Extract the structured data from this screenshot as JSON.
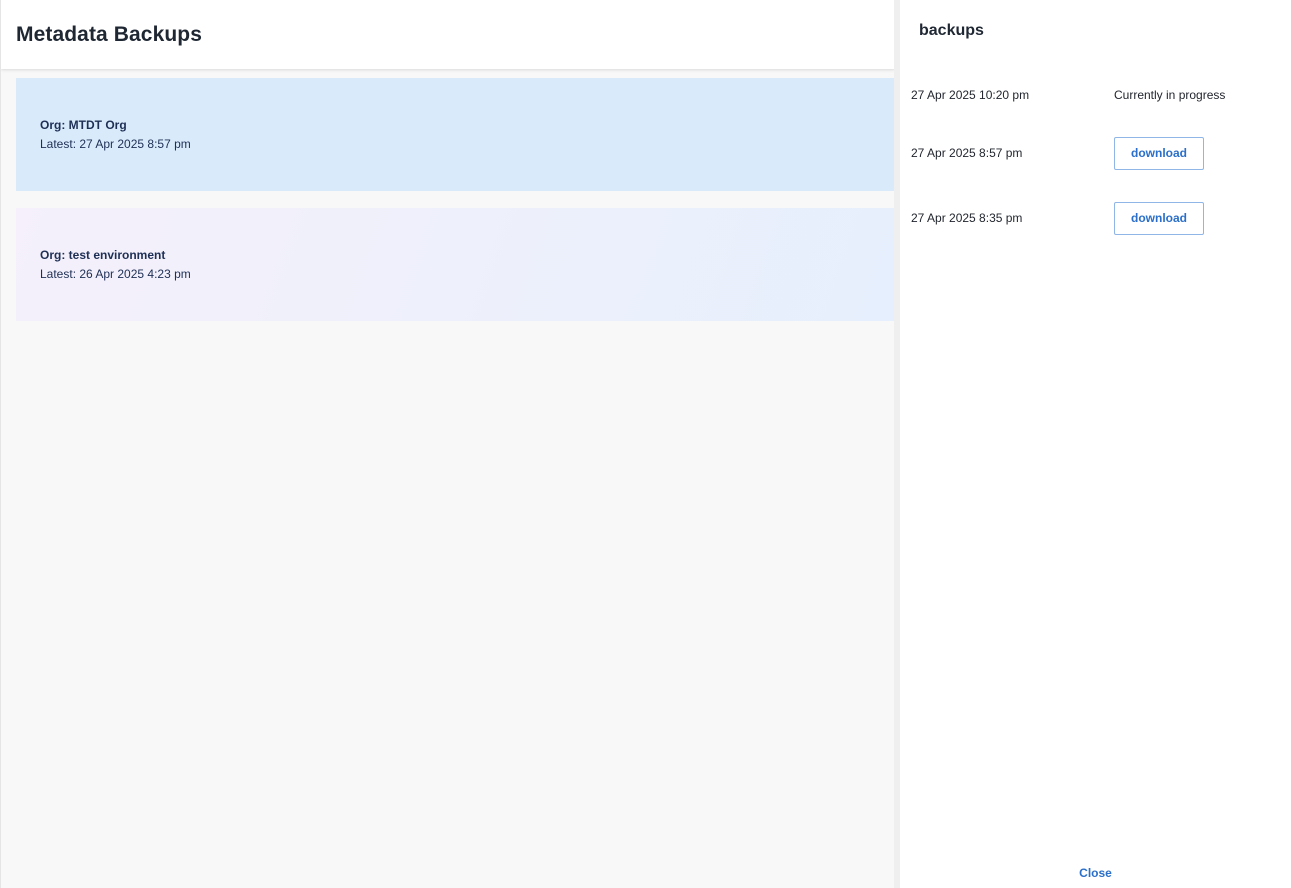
{
  "header": {
    "title": "Metadata Backups"
  },
  "orgs": [
    {
      "name": "Org: MTDT Org",
      "latest": "Latest: 27 Apr 2025 8:57 pm",
      "selected": true
    },
    {
      "name": "Org: test environment",
      "latest": "Latest: 26 Apr 2025 4:23 pm",
      "selected": false
    }
  ],
  "panel": {
    "title": "backups",
    "backups": [
      {
        "date": "27 Apr 2025 10:20 pm",
        "status": "Currently in progress"
      },
      {
        "date": "27 Apr 2025 8:57 pm",
        "action": "download"
      },
      {
        "date": "27 Apr 2025 8:35 pm",
        "action": "download"
      }
    ],
    "close_label": "Close"
  },
  "colors": {
    "selected_card": "#d9ebfb",
    "accent": "#2a6fc9",
    "text_dark": "#1e2f55"
  }
}
